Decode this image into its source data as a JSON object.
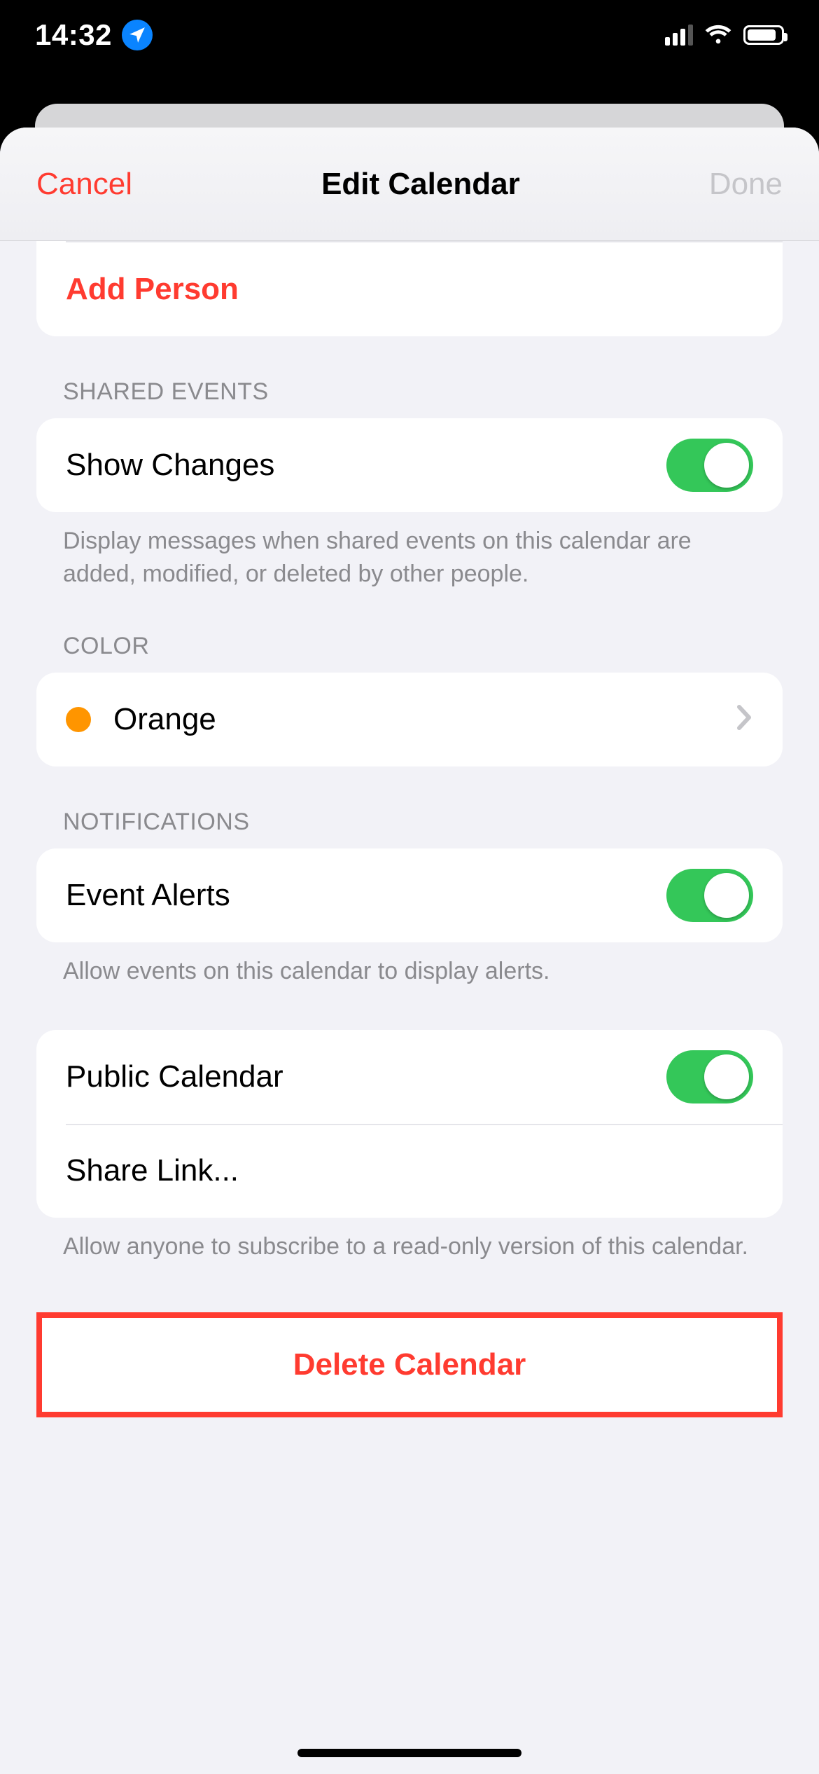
{
  "status": {
    "time": "14:32"
  },
  "modal": {
    "cancel": "Cancel",
    "title": "Edit Calendar",
    "done": "Done"
  },
  "shared_with": {
    "add_person": "Add Person"
  },
  "shared_events": {
    "header": "SHARED EVENTS",
    "show_changes_label": "Show Changes",
    "show_changes_on": true,
    "footer": "Display messages when shared events on this calendar are added, modified, or deleted by other people."
  },
  "color": {
    "header": "COLOR",
    "name": "Orange",
    "hex": "#ff9500"
  },
  "notifications": {
    "header": "NOTIFICATIONS",
    "event_alerts_label": "Event Alerts",
    "event_alerts_on": true,
    "footer": "Allow events on this calendar to display alerts."
  },
  "public": {
    "public_label": "Public Calendar",
    "public_on": true,
    "share_link_label": "Share Link...",
    "footer": "Allow anyone to subscribe to a read-only version of this calendar."
  },
  "delete": {
    "label": "Delete Calendar"
  }
}
